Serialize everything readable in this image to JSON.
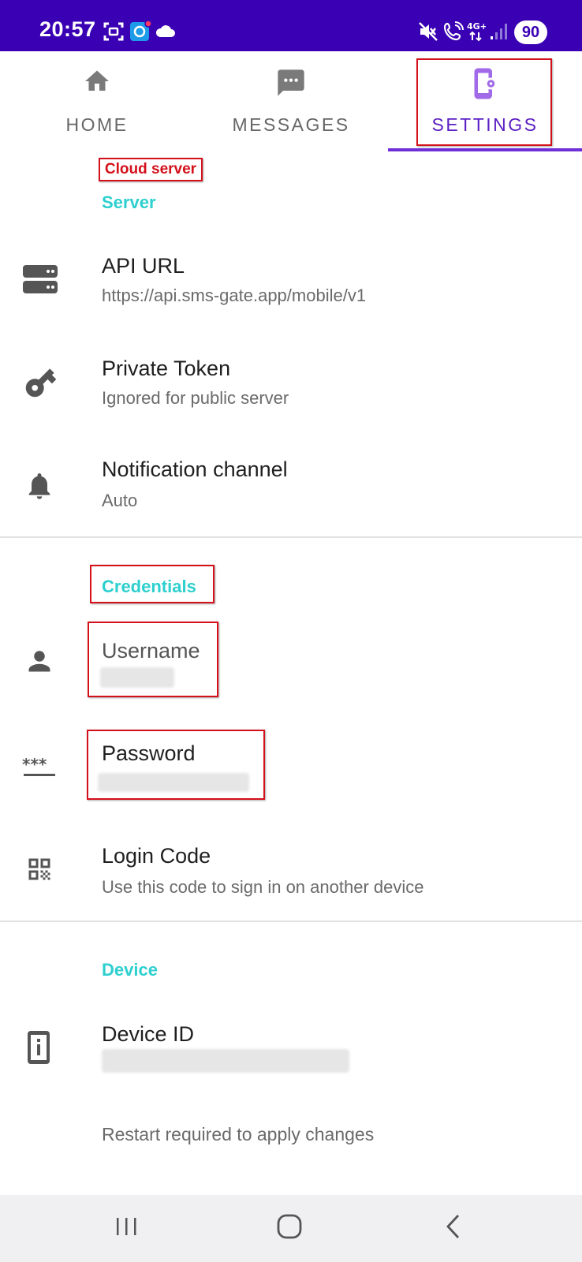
{
  "status_bar": {
    "time": "20:57",
    "battery": "90"
  },
  "tabs": [
    {
      "label": "HOME",
      "icon": "home-icon",
      "active": false
    },
    {
      "label": "MESSAGES",
      "icon": "message-icon",
      "active": false
    },
    {
      "label": "SETTINGS",
      "icon": "settings-phone-icon",
      "active": true
    }
  ],
  "annotation": {
    "cloud_server_label": "Cloud server"
  },
  "sections": {
    "server": {
      "header": "Server",
      "items": [
        {
          "title": "API URL",
          "summary": "https://api.sms-gate.app/mobile/v1",
          "icon": "server-icon"
        },
        {
          "title": "Private Token",
          "summary": "Ignored for public server",
          "icon": "key-icon"
        },
        {
          "title": "Notification channel",
          "summary": "Auto",
          "icon": "bell-icon"
        }
      ]
    },
    "credentials": {
      "header": "Credentials",
      "items": [
        {
          "title": "Username",
          "icon": "person-icon"
        },
        {
          "title": "Password",
          "icon": "password-icon"
        },
        {
          "title": "Login Code",
          "summary": "Use this code to sign in on another device",
          "icon": "qr-code-icon"
        }
      ]
    },
    "device": {
      "header": "Device",
      "items": [
        {
          "title": "Device ID",
          "icon": "device-info-icon"
        }
      ],
      "footer": "Restart required to apply changes"
    }
  },
  "colors": {
    "status_bar": "#3a00b4",
    "accent": "#5b1fc4",
    "section_header": "#2ecfcf",
    "annotation": "#d4101a"
  }
}
